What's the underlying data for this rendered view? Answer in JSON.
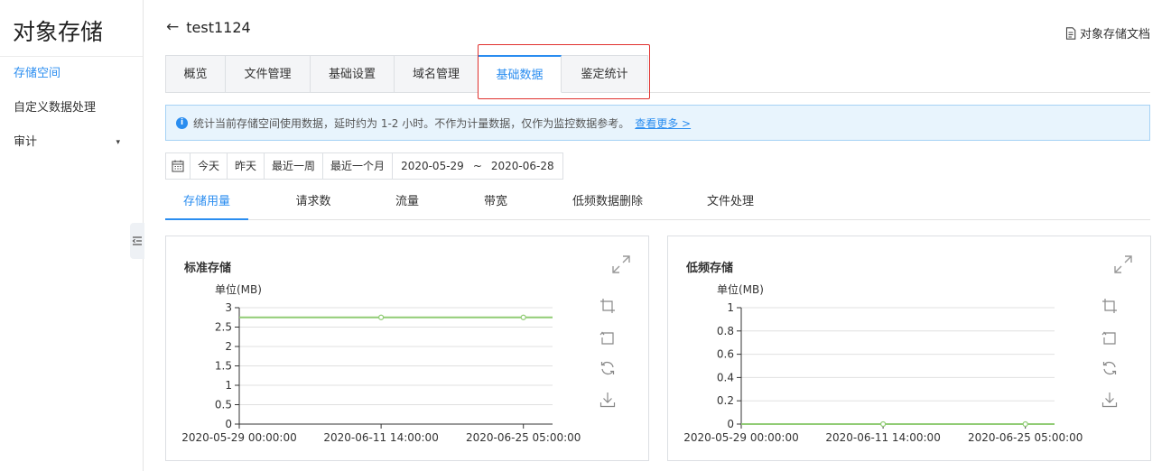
{
  "sidebar": {
    "brand": "对象存储",
    "items": [
      {
        "label": "存储空间",
        "active": true
      },
      {
        "label": "自定义数据处理",
        "active": false
      },
      {
        "label": "审计",
        "active": false,
        "caret": "▾"
      }
    ]
  },
  "header": {
    "back_arrow": "←",
    "bucket_name": "test1124",
    "doc_link": "对象存储文档"
  },
  "tabs": [
    {
      "label": "概览",
      "active": false
    },
    {
      "label": "文件管理",
      "active": false
    },
    {
      "label": "基础设置",
      "active": false
    },
    {
      "label": "域名管理",
      "active": false
    },
    {
      "label": "基础数据",
      "active": true
    },
    {
      "label": "鉴定统计",
      "active": false
    }
  ],
  "infobar": {
    "icon": "i",
    "text": "统计当前存储空间使用数据，延时约为 1-2 小时。不作为计量数据，仅作为监控数据参考。",
    "link": "查看更多 >"
  },
  "daterange": {
    "presets": [
      "今天",
      "昨天",
      "最近一周",
      "最近一个月"
    ],
    "start": "2020-05-29",
    "separator": "~",
    "end": "2020-06-28"
  },
  "subtabs": [
    {
      "label": "存储用量",
      "active": true
    },
    {
      "label": "请求数",
      "active": false
    },
    {
      "label": "流量",
      "active": false
    },
    {
      "label": "带宽",
      "active": false
    },
    {
      "label": "低频数据删除",
      "active": false
    },
    {
      "label": "文件处理",
      "active": false
    }
  ],
  "colors": {
    "accent": "#2a8df0",
    "line": "#91cc75",
    "highlight": "#e0312e"
  },
  "chart_data": [
    {
      "type": "line",
      "title": "标准存储",
      "ylabel": "单位(MB)",
      "ylim": [
        0,
        3
      ],
      "yticks": [
        "0",
        "0.5",
        "1",
        "1.5",
        "2",
        "2.5",
        "3"
      ],
      "xticks": [
        "2020-05-29 00:00:00",
        "2020-06-11 14:00:00",
        "2020-06-25 05:00:00"
      ],
      "series": [
        {
          "x": [
            "2020-05-29 00:00:00",
            "2020-06-11 14:00:00",
            "2020-06-25 05:00:00",
            "2020-06-28 00:00:00"
          ],
          "y": [
            2.75,
            2.75,
            2.75,
            2.75
          ]
        }
      ]
    },
    {
      "type": "line",
      "title": "低频存储",
      "ylabel": "单位(MB)",
      "ylim": [
        0,
        1
      ],
      "yticks": [
        "0",
        "0.2",
        "0.4",
        "0.6",
        "0.8",
        "1"
      ],
      "xticks": [
        "2020-05-29 00:00:00",
        "2020-06-11 14:00:00",
        "2020-06-25 05:00:00"
      ],
      "series": [
        {
          "x": [
            "2020-05-29 00:00:00",
            "2020-06-11 14:00:00",
            "2020-06-25 05:00:00",
            "2020-06-28 00:00:00"
          ],
          "y": [
            0,
            0,
            0,
            0
          ]
        }
      ]
    }
  ]
}
